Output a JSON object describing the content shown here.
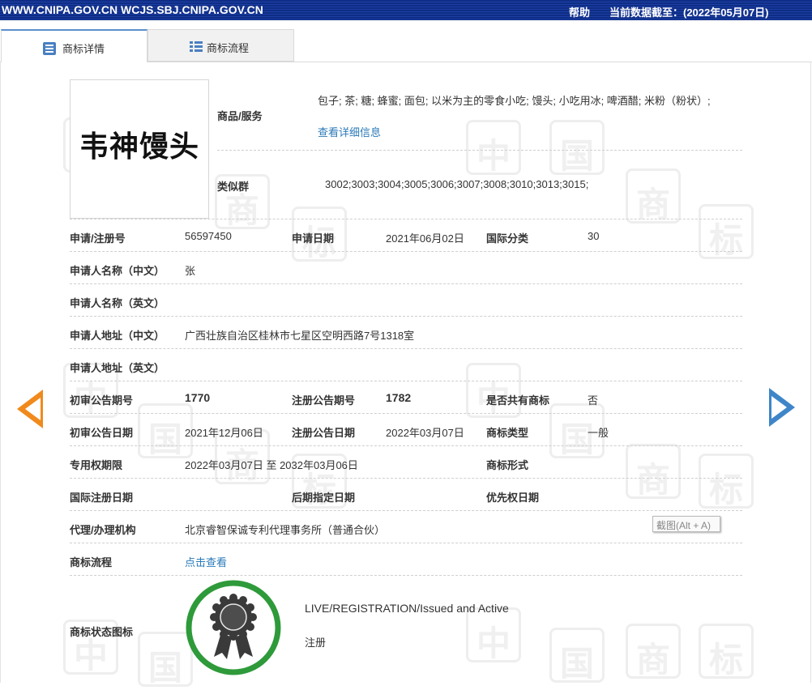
{
  "topbar": {
    "site": "WWW.CNIPA.GOV.CN WCJS.SBJ.CNIPA.GOV.CN",
    "help": "帮助",
    "data_as_of": "当前数据截至：(2022年05月07日)"
  },
  "tabs": [
    {
      "label": "商标详情",
      "icon": "list-detail-icon",
      "active": true
    },
    {
      "label": "商标流程",
      "icon": "list-flow-icon",
      "active": false
    }
  ],
  "logo": {
    "text": "韦神馒头"
  },
  "goods": {
    "label": "商品/服务",
    "value": "包子; 茶; 糖; 蜂蜜; 面包; 以米为主的零食小吃; 馒头; 小吃用冰; 啤酒醋; 米粉（粉状）;",
    "link": "查看详细信息"
  },
  "similar_group": {
    "label": "类似群",
    "value": "3002;3003;3004;3005;3006;3007;3008;3010;3013;3015;"
  },
  "fields": {
    "reg_no": {
      "label": "申请/注册号",
      "value": "56597450"
    },
    "app_date": {
      "label": "申请日期",
      "value": "2021年06月02日"
    },
    "intl_class": {
      "label": "国际分类",
      "value": "30"
    },
    "applicant_cn": {
      "label": "申请人名称（中文）",
      "value": "张"
    },
    "applicant_en": {
      "label": "申请人名称（英文）",
      "value": ""
    },
    "address_cn": {
      "label": "申请人地址（中文）",
      "value": "广西壮族自治区桂林市七星区空明西路7号1318室"
    },
    "address_en": {
      "label": "申请人地址（英文）",
      "value": ""
    },
    "prelim_issue": {
      "label": "初审公告期号",
      "value": "1770"
    },
    "reg_issue": {
      "label": "注册公告期号",
      "value": "1782"
    },
    "shared": {
      "label": "是否共有商标",
      "value": "否"
    },
    "prelim_date": {
      "label": "初审公告日期",
      "value": "2021年12月06日"
    },
    "reg_date": {
      "label": "注册公告日期",
      "value": "2022年03月07日"
    },
    "tm_type": {
      "label": "商标类型",
      "value": "一般"
    },
    "exclusive_period": {
      "label": "专用权期限",
      "value": "2022年03月07日 至 2032年03月06日"
    },
    "tm_form": {
      "label": "商标形式",
      "value": ""
    },
    "intl_reg_date": {
      "label": "国际注册日期",
      "value": ""
    },
    "later_designation": {
      "label": "后期指定日期",
      "value": ""
    },
    "priority_date": {
      "label": "优先权日期",
      "value": ""
    },
    "agency": {
      "label": "代理/办理机构",
      "value": "北京睿智保诚专利代理事务所（普通合伙）"
    },
    "process": {
      "label": "商标流程",
      "link": "点击查看"
    }
  },
  "status": {
    "label": "商标状态图标",
    "line1": "LIVE/REGISTRATION/Issued and Active",
    "line2": "注册",
    "ring_color": "#2e9a3a"
  },
  "tooltip": "截图(Alt + A)",
  "watermark_chars": [
    "中",
    "国",
    "商",
    "标"
  ],
  "colors": {
    "topbar": "#0f2d86",
    "link": "#2a7ab9",
    "arrow_prev": "#f08a1c",
    "arrow_next": "#3f86c8"
  }
}
